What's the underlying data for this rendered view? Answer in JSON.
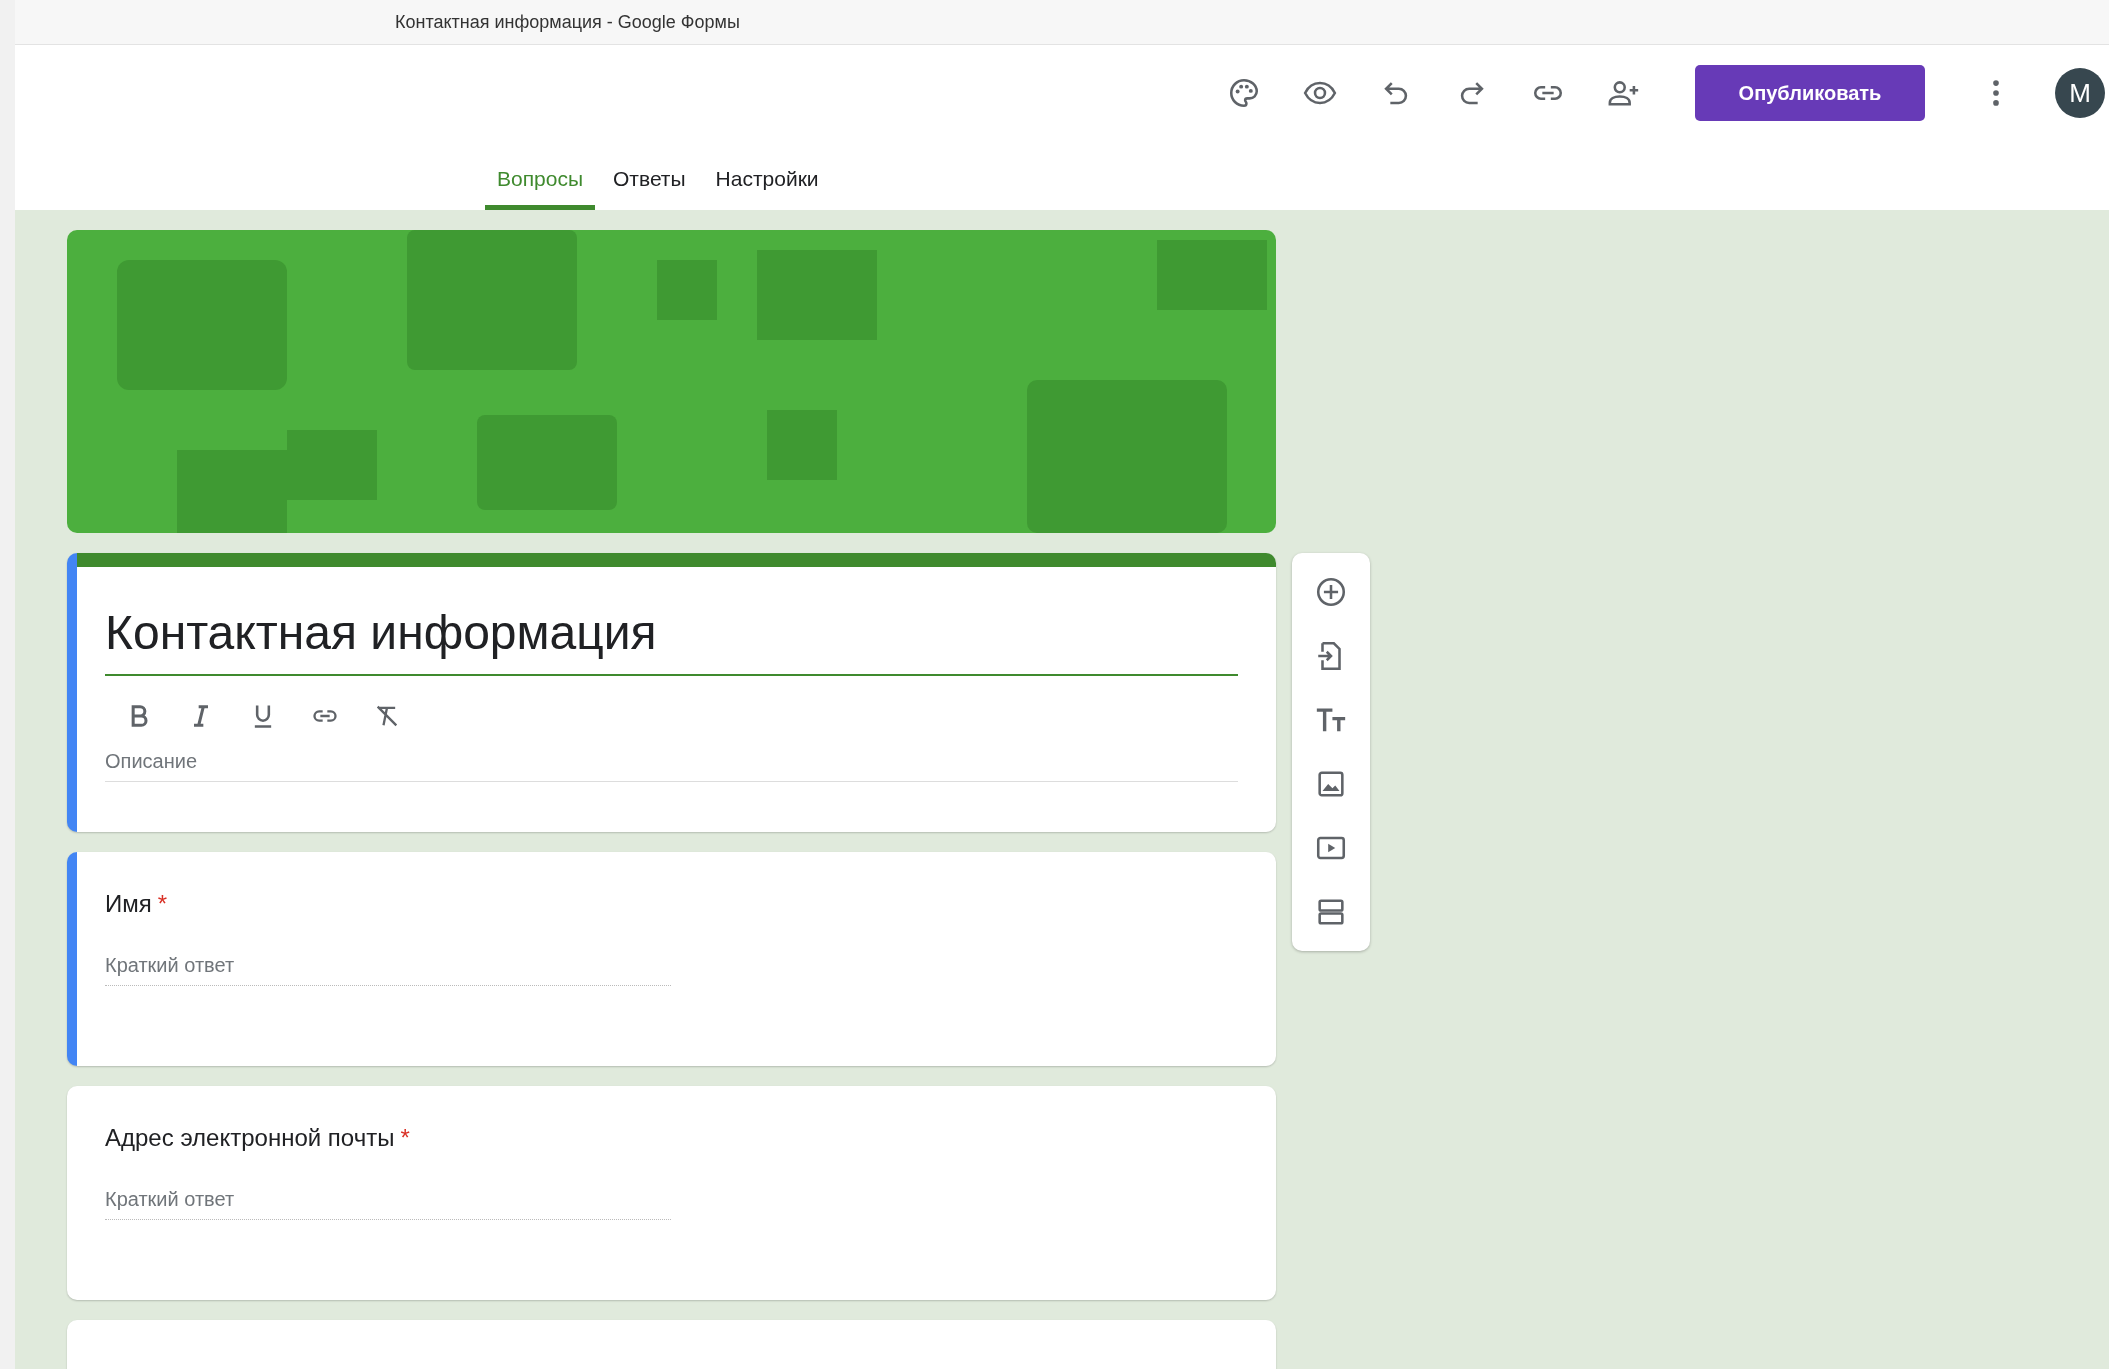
{
  "browser_tab": {
    "title": "Контактная информация - Google Формы"
  },
  "toolbar": {
    "publish_button": "Опубликовать",
    "avatar": "M"
  },
  "tabs": [
    {
      "label": "Вопросы",
      "selected": true
    },
    {
      "label": "Ответы",
      "selected": false
    },
    {
      "label": "Настройки",
      "selected": false
    }
  ],
  "form_header": {
    "title": "Контактная информация",
    "description_placeholder": "Описание",
    "active": true
  },
  "questions": [
    {
      "title": "Имя",
      "required": true,
      "required_mark": "*",
      "answer_placeholder": "Краткий ответ",
      "active": true
    },
    {
      "title": "Адрес электронной почты",
      "required": true,
      "required_mark": "*",
      "answer_placeholder": "Краткий ответ",
      "active": false
    }
  ]
}
